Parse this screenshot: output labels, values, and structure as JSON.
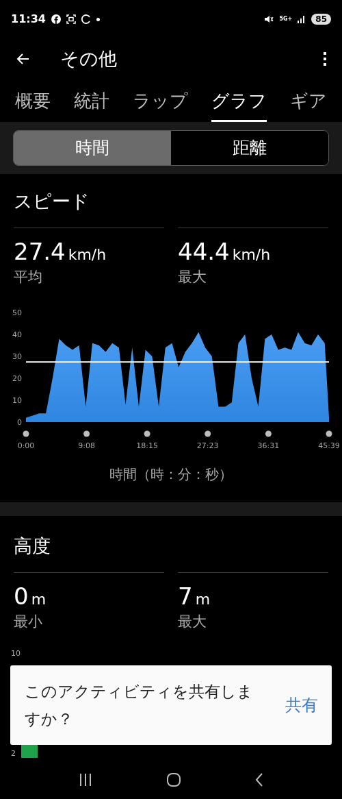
{
  "status_bar": {
    "time": "11:34",
    "network": "5G+",
    "battery": "85"
  },
  "app_bar": {
    "title": "その他"
  },
  "tabs": [
    {
      "label": "概要",
      "selected": false
    },
    {
      "label": "統計",
      "selected": false
    },
    {
      "label": "ラップ",
      "selected": false
    },
    {
      "label": "グラフ",
      "selected": true
    },
    {
      "label": "ギア",
      "selected": false
    }
  ],
  "segments": [
    {
      "label": "時間",
      "selected": true
    },
    {
      "label": "距離",
      "selected": false
    }
  ],
  "speed": {
    "title": "スピード",
    "stats": [
      {
        "value": "27.4",
        "unit": "km/h",
        "label": "平均"
      },
      {
        "value": "44.4",
        "unit": "km/h",
        "label": "最大"
      }
    ],
    "chart_data": {
      "type": "area",
      "xlabel": "時間（時：分：秒）",
      "x": [
        0,
        1,
        2,
        3,
        4,
        5,
        6,
        7,
        8,
        9,
        10,
        11,
        12,
        13,
        14,
        15,
        16,
        17,
        18,
        19,
        20,
        21,
        22,
        23,
        24,
        25,
        26,
        27,
        28,
        29,
        30,
        31,
        32,
        33,
        34,
        35,
        36,
        37,
        38,
        39,
        40,
        41,
        42,
        43,
        44,
        45,
        45.65
      ],
      "series": [
        {
          "color": "#2f86e0",
          "values": [
            2,
            3,
            4,
            4,
            20,
            38,
            35,
            33,
            35,
            7,
            36,
            35,
            32,
            36,
            34,
            8,
            34,
            7,
            33,
            30,
            7,
            34,
            36,
            25,
            32,
            36,
            41,
            34,
            30,
            7,
            7,
            9,
            36,
            40,
            20,
            7,
            38,
            40,
            33,
            34,
            33,
            41,
            36,
            35,
            40,
            36,
            2
          ]
        },
        {
          "type": "line",
          "color": "#ffffff",
          "values": [
            27.4,
            27.4,
            27.4,
            27.4,
            27.4,
            27.4,
            27.4,
            27.4,
            27.4,
            27.4,
            27.4,
            27.4,
            27.4,
            27.4,
            27.4,
            27.4,
            27.4,
            27.4,
            27.4,
            27.4,
            27.4,
            27.4,
            27.4,
            27.4,
            27.4,
            27.4,
            27.4,
            27.4,
            27.4,
            27.4,
            27.4,
            27.4,
            27.4,
            27.4,
            27.4,
            27.4,
            27.4,
            27.4,
            27.4,
            27.4,
            27.4,
            27.4,
            27.4,
            27.4,
            27.4,
            27.4,
            27.4
          ]
        }
      ],
      "xlim": [
        0,
        45.65
      ],
      "ylim": [
        0,
        50
      ],
      "yticks": [
        0,
        10,
        20,
        30,
        40,
        50
      ],
      "xticks": [
        {
          "value": 0,
          "label": "0:00"
        },
        {
          "value": 9.13,
          "label": "9:08"
        },
        {
          "value": 18.25,
          "label": "18:15"
        },
        {
          "value": 27.38,
          "label": "27:23"
        },
        {
          "value": 36.52,
          "label": "36:31"
        },
        {
          "value": 45.65,
          "label": "45:39"
        }
      ]
    }
  },
  "altitude": {
    "title": "高度",
    "stats": [
      {
        "value": "0",
        "unit": "m",
        "label": "最小"
      },
      {
        "value": "7",
        "unit": "m",
        "label": "最大"
      }
    ],
    "axis_labels": [
      "10",
      "2"
    ]
  },
  "share_prompt": {
    "message": "このアクティビティを共有しますか？",
    "action": "共有"
  }
}
